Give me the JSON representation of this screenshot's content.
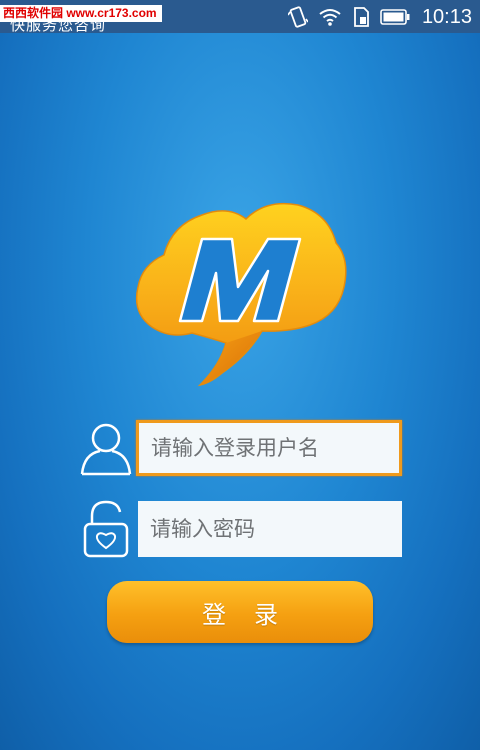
{
  "status_bar": {
    "watermark": "西西软件园 www.cr173.com",
    "app_title_peek": "快服务您咨询",
    "time": "10:13",
    "icons": [
      "vibrate-icon",
      "wifi-icon",
      "sim-icon",
      "battery-icon"
    ]
  },
  "logo": {
    "letter": "M",
    "colors": {
      "primary": "#f7a41a",
      "secondary": "#ffd020",
      "letter": "#1e7fd0"
    }
  },
  "login_form": {
    "username_placeholder": "请输入登录用户名",
    "username_value": "",
    "password_placeholder": "请输入密码",
    "password_value": "",
    "login_button": "登录"
  },
  "colors": {
    "background": "#1f86d2",
    "accent": "#f5a011",
    "focus_border": "#ef9a1c"
  }
}
